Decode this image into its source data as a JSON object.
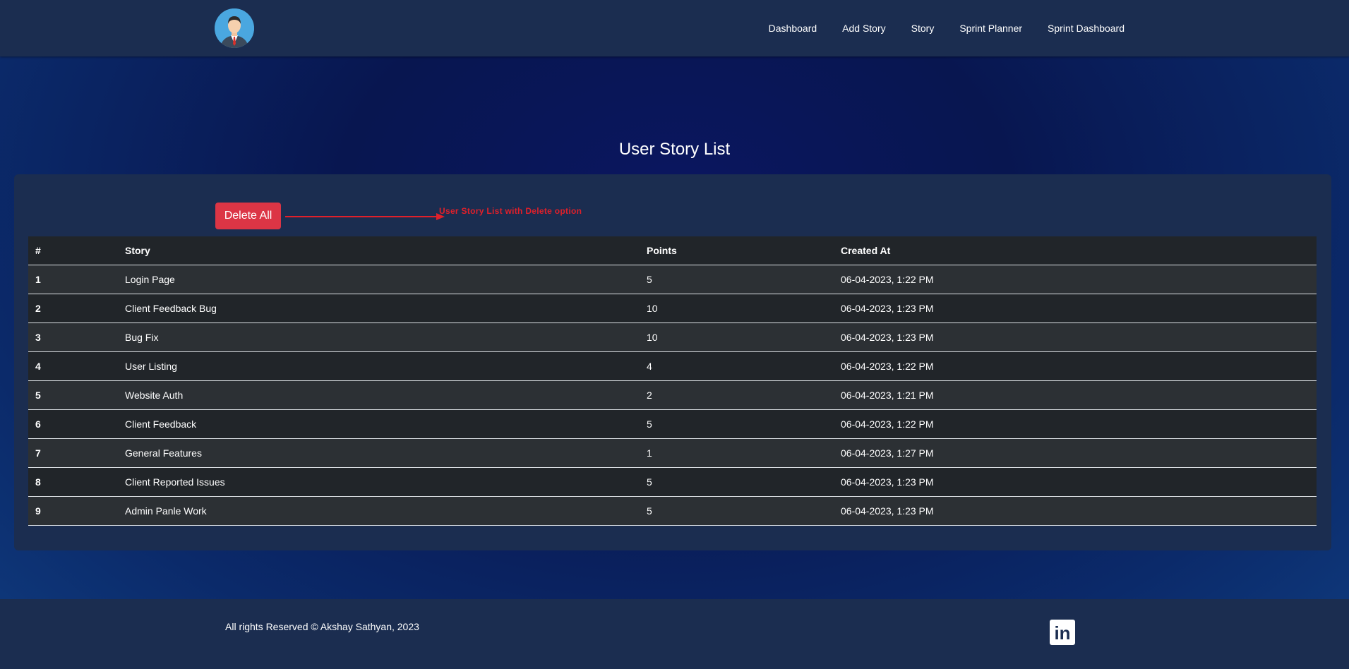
{
  "nav": {
    "items": [
      {
        "label": "Dashboard"
      },
      {
        "label": "Add Story"
      },
      {
        "label": "Story"
      },
      {
        "label": "Sprint Planner"
      },
      {
        "label": "Sprint Dashboard"
      }
    ]
  },
  "page": {
    "title": "User Story List"
  },
  "actions": {
    "delete_all_label": "Delete All"
  },
  "annotation": {
    "text": "User Story List with Delete option",
    "color": "#e0202a"
  },
  "table": {
    "headers": [
      "#",
      "Story",
      "Points",
      "Created At"
    ],
    "rows": [
      {
        "num": "1",
        "story": "Login Page",
        "points": "5",
        "created": "06-04-2023, 1:22 PM"
      },
      {
        "num": "2",
        "story": "Client Feedback Bug",
        "points": "10",
        "created": "06-04-2023, 1:23 PM"
      },
      {
        "num": "3",
        "story": "Bug Fix",
        "points": "10",
        "created": "06-04-2023, 1:23 PM"
      },
      {
        "num": "4",
        "story": "User Listing",
        "points": "4",
        "created": "06-04-2023, 1:22 PM"
      },
      {
        "num": "5",
        "story": "Website Auth",
        "points": "2",
        "created": "06-04-2023, 1:21 PM"
      },
      {
        "num": "6",
        "story": "Client Feedback",
        "points": "5",
        "created": "06-04-2023, 1:22 PM"
      },
      {
        "num": "7",
        "story": "General Features",
        "points": "1",
        "created": "06-04-2023, 1:27 PM"
      },
      {
        "num": "8",
        "story": "Client Reported Issues",
        "points": "5",
        "created": "06-04-2023, 1:23 PM"
      },
      {
        "num": "9",
        "story": "Admin Panle Work",
        "points": "5",
        "created": "06-04-2023, 1:23 PM"
      }
    ]
  },
  "footer": {
    "copyright": "All rights Reserved © Akshay Sathyan, 2023",
    "linkedin_glyph": "in"
  },
  "colors": {
    "navbar": "#1b2d50",
    "danger": "#dc3545",
    "table_dark": "#212529",
    "table_striped": "#2c3034"
  }
}
